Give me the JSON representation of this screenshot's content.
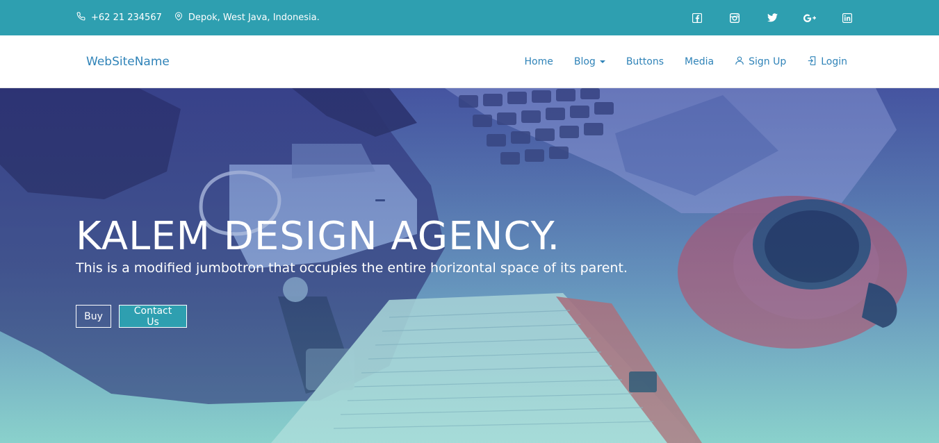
{
  "topbar": {
    "phone": "+62 21 234567",
    "location": "Depok, West Java, Indonesia.",
    "social": [
      "facebook-icon",
      "instagram-icon",
      "twitter-icon",
      "google-plus-icon",
      "linkedin-icon"
    ]
  },
  "navbar": {
    "brand": "WebSiteName",
    "links": {
      "home": "Home",
      "blog": "Blog",
      "buttons": "Buttons",
      "media": "Media",
      "signup": "Sign Up",
      "login": "Login"
    }
  },
  "hero": {
    "title": "KALEM DESIGN AGENCY.",
    "subtitle": "This is a modified jumbotron that occupies the entire horizontal space of its parent.",
    "buy_label": "Buy",
    "contact_label": "Contact Us"
  },
  "colors": {
    "brand": "#2e9fb0",
    "link": "#2f83b8"
  }
}
